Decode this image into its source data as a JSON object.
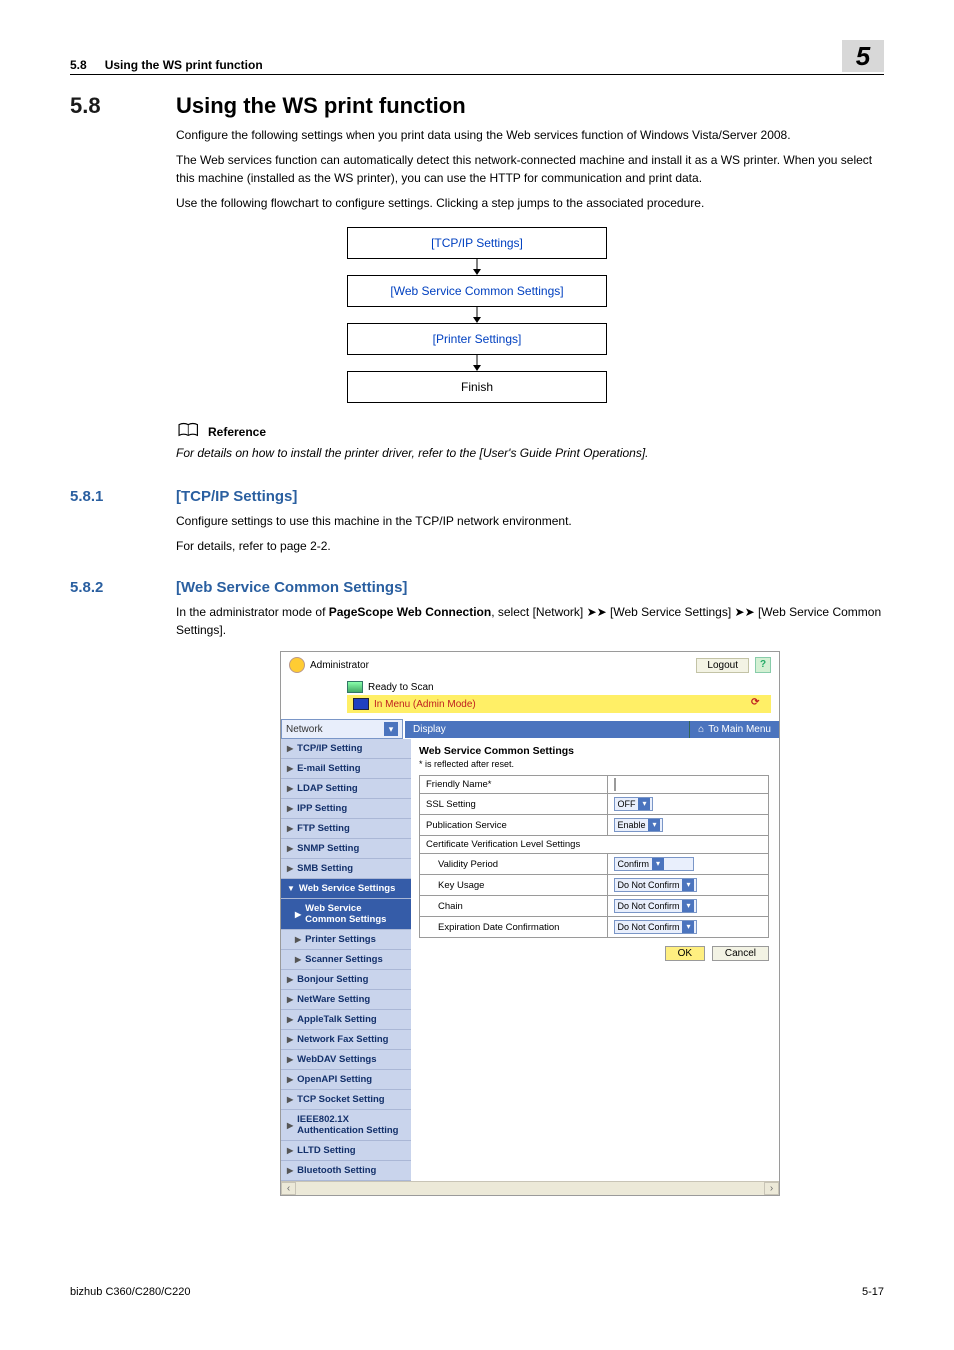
{
  "header": {
    "sec_no": "5.8",
    "sec_label": "Using the WS print function",
    "chapter_badge": "5"
  },
  "s58": {
    "num": "5.8",
    "title": "Using the WS print function",
    "p1": "Configure the following settings when you print data using the Web services function of Windows Vista/Server 2008.",
    "p2": "The Web services function can automatically detect this network-connected machine and install it as a WS printer. When you select this machine (installed as the WS printer), you can use the HTTP for communication and print data.",
    "p3": "Use the following flowchart to configure settings. Clicking a step jumps to the associated procedure."
  },
  "flow": {
    "b1": "[TCP/IP Settings]",
    "b2": "[Web Service Common Settings]",
    "b3": "[Printer Settings]",
    "b4": "Finish"
  },
  "ref": {
    "title": "Reference",
    "body": "For details on how to install the printer driver, refer to the [User's Guide Print Operations]."
  },
  "s581": {
    "num": "5.8.1",
    "title": "[TCP/IP Settings]",
    "p1": "Configure settings to use this machine in the TCP/IP network environment.",
    "p2": "For details, refer to page 2-2."
  },
  "s582": {
    "num": "5.8.2",
    "title": "[Web Service Common Settings]",
    "p1_a": "In the administrator mode of ",
    "p1_bold": "PageScope Web Connection",
    "p1_b": ", select [Network] ➤➤ [Web Service Settings] ➤➤ [Web Service Common Settings]."
  },
  "shot": {
    "admin": "Administrator",
    "logout": "Logout",
    "help": "?",
    "ready": "Ready to Scan",
    "inmenu": "In Menu (Admin Mode)",
    "net_select": "Network",
    "display": "Display",
    "mainmenu": "To Main Menu",
    "side": {
      "tcpip": "TCP/IP Setting",
      "email": "E-mail Setting",
      "ldap": "LDAP Setting",
      "ipp": "IPP Setting",
      "ftp": "FTP Setting",
      "snmp": "SNMP Setting",
      "smb": "SMB Setting",
      "wss": "Web Service Settings",
      "wsc": "Web Service Common Settings",
      "printer": "Printer Settings",
      "scanner": "Scanner Settings",
      "bonjour": "Bonjour Setting",
      "netware": "NetWare Setting",
      "appletalk": "AppleTalk Setting",
      "netfax": "Network Fax Setting",
      "webdav": "WebDAV Settings",
      "openapi": "OpenAPI Setting",
      "tcpsock": "TCP Socket Setting",
      "ieee": "IEEE802.1X Authentication Setting",
      "lltd": "LLTD Setting",
      "bt": "Bluetooth Setting"
    },
    "panel": {
      "title": "Web Service Common Settings",
      "note": "* is reflected after reset.",
      "rows": {
        "friendly": "Friendly Name*",
        "ssl": "SSL Setting",
        "ssl_v": "OFF",
        "pub": "Publication Service",
        "pub_v": "Enable",
        "cert": "Certificate Verification Level Settings",
        "validity": "Validity Period",
        "validity_v": "Confirm",
        "key": "Key Usage",
        "key_v": "Do Not Confirm",
        "chain": "Chain",
        "chain_v": "Do Not Confirm",
        "exp": "Expiration Date Confirmation",
        "exp_v": "Do Not Confirm"
      },
      "ok": "OK",
      "cancel": "Cancel"
    }
  },
  "footer": {
    "left": "bizhub C360/C280/C220",
    "right": "5-17"
  }
}
